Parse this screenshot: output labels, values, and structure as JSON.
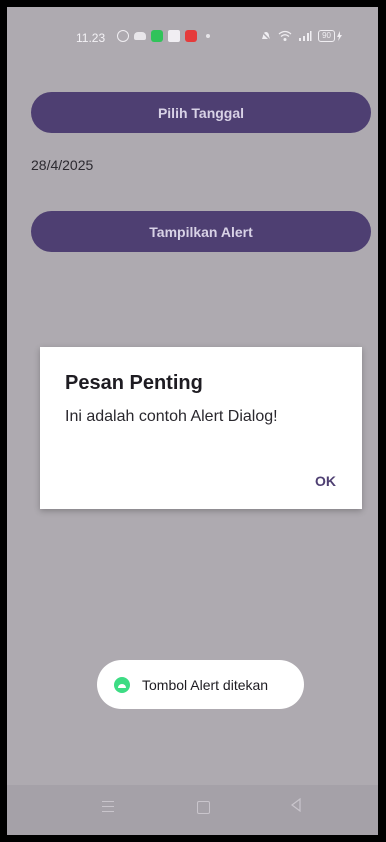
{
  "status_bar": {
    "time": "11.23",
    "battery": "90",
    "notification_icons": [
      "whatsapp-icon",
      "car-icon",
      "green-app-icon",
      "message-icon",
      "red-app-icon"
    ],
    "right_icons": [
      "mute-icon",
      "wifi-icon",
      "signal-icon",
      "battery-icon"
    ]
  },
  "buttons": {
    "pick_date": "Pilih Tanggal",
    "show_alert": "Tampilkan Alert"
  },
  "selected_date": "28/4/2025",
  "dialog": {
    "title": "Pesan Penting",
    "message": "Ini adalah contoh Alert Dialog!",
    "ok_label": "OK"
  },
  "toast": {
    "text": "Tombol Alert ditekan"
  },
  "nav_bar": [
    "menu-icon",
    "home-icon",
    "back-icon"
  ],
  "colors": {
    "button": "#4e3f72",
    "scrim_background": "#aeaab0",
    "dialog": "#ffffff",
    "toast_icon": "#3ddc84"
  }
}
